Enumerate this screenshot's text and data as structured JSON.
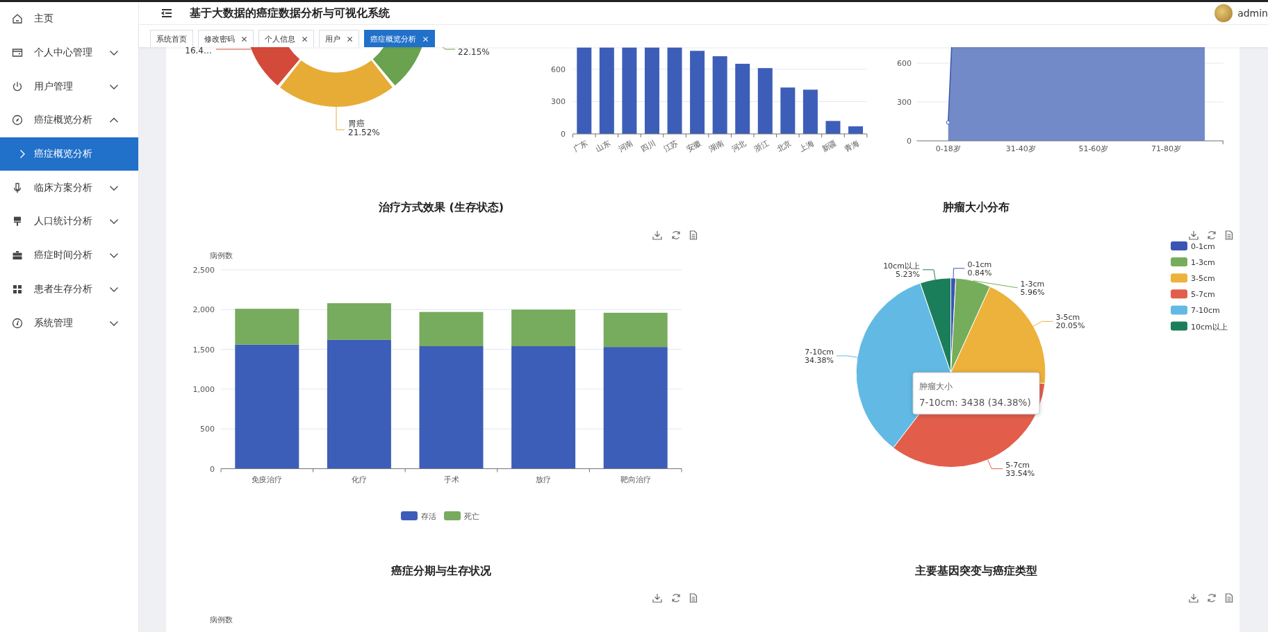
{
  "header": {
    "title": "基于大数据的癌症数据分析与可视化系统",
    "user": "admin"
  },
  "sidebar": {
    "items": [
      {
        "kind": "link",
        "label": "主页"
      },
      {
        "kind": "group",
        "label": "个人中心管理",
        "expanded": false
      },
      {
        "kind": "group",
        "label": "用户管理",
        "expanded": false
      },
      {
        "kind": "group",
        "label": "癌症概览分析",
        "expanded": true,
        "children": [
          {
            "label": "癌症概览分析",
            "selected": true
          }
        ]
      },
      {
        "kind": "group",
        "label": "临床方案分析",
        "expanded": false
      },
      {
        "kind": "group",
        "label": "人口统计分析",
        "expanded": false
      },
      {
        "kind": "group",
        "label": "癌症时间分析",
        "expanded": false
      },
      {
        "kind": "group",
        "label": "患者生存分析",
        "expanded": false
      },
      {
        "kind": "group",
        "label": "系统管理",
        "expanded": false
      }
    ]
  },
  "tabs": [
    {
      "label": "系统首页",
      "closable": false,
      "selected": false
    },
    {
      "label": "修改密码",
      "closable": true,
      "selected": false
    },
    {
      "label": "个人信息",
      "closable": true,
      "selected": false
    },
    {
      "label": "用户",
      "closable": true,
      "selected": false
    },
    {
      "label": "癌症概览分析",
      "closable": true,
      "selected": true
    }
  ],
  "charts": {
    "cancer_type_donut": {
      "kind": "picture",
      "segments": [
        {
          "percent": "16.4…",
          "color": "#d44a3a"
        },
        {
          "percent": "22.15%",
          "color": "#6aa24f"
        },
        {
          "name": "胃癌",
          "percent": "21.52%",
          "color": "#e7ac35"
        }
      ]
    },
    "province_bar": {
      "chart_data": {
        "type": "bar",
        "categories": [
          "广东",
          "山东",
          "河南",
          "四川",
          "江苏",
          "安徽",
          "湖南",
          "河北",
          "浙江",
          "北京",
          "上海",
          "新疆",
          "青海"
        ],
        "values": [
          800,
          800,
          800,
          800,
          800,
          770,
          720,
          650,
          610,
          430,
          410,
          120,
          70
        ],
        "ylim": [
          0,
          804
        ],
        "yticks": [
          0,
          300,
          600
        ]
      }
    },
    "age_area": {
      "kind": "picture",
      "x_labels": [
        "0-18岁",
        "31-40岁",
        "51-60岁",
        "71-80岁"
      ],
      "y_labels": [
        "600",
        "300",
        "0"
      ]
    },
    "treatment": {
      "chart_data": {
        "type": "bar",
        "stacked": true,
        "grid": true,
        "legend": true,
        "title": "治疗方式效果 (生存状态)",
        "ylabel": "病例数",
        "categories": [
          "免疫治疗",
          "化疗",
          "手术",
          "放疗",
          "靶向治疗"
        ],
        "series": [
          {
            "name": "存活",
            "color": "#3d5eb8",
            "values": [
              1560,
              1620,
              1540,
              1540,
              1530
            ]
          },
          {
            "name": "死亡",
            "color": "#77ab5d",
            "values": [
              450,
              460,
              430,
              460,
              430
            ]
          }
        ],
        "ylim": [
          0,
          2500
        ],
        "yticks": [
          {
            "value": 0,
            "label": "0"
          },
          {
            "value": 500,
            "label": "500"
          },
          {
            "value": 1000,
            "label": "1,000"
          },
          {
            "value": 1500,
            "label": "1,500"
          },
          {
            "value": 2000,
            "label": "2,000"
          },
          {
            "value": 2500,
            "label": "2,500"
          }
        ]
      }
    },
    "tumor_size": {
      "chart_data": {
        "type": "pie",
        "title": "肿瘤大小分布",
        "categories": [
          "0-1cm",
          "1-3cm",
          "3-5cm",
          "5-7cm",
          "7-10cm",
          "10cm以上"
        ],
        "values": [
          0.84,
          5.96,
          20.05,
          33.54,
          34.38,
          5.23
        ],
        "value_labels": [
          "0.84%",
          "5.96%",
          "20.05%",
          "33.54%",
          "34.38%",
          "5.23%"
        ]
      },
      "legend": [
        {
          "label": "0-1cm",
          "color": "#3a55b4"
        },
        {
          "label": "1-3cm",
          "color": "#76ad5a"
        },
        {
          "label": "3-5cm",
          "color": "#ecb23b"
        },
        {
          "label": "5-7cm",
          "color": "#e35d4b"
        },
        {
          "label": "7-10cm",
          "color": "#62bae4"
        },
        {
          "label": "10cm以上",
          "color": "#1b7e5b"
        }
      ],
      "tooltip": {
        "title": "肿瘤大小",
        "text": "7-10cm: 3438 (34.38%)"
      }
    },
    "stage": {
      "title": "癌症分期与生存状况",
      "ylabel": "病例数"
    },
    "gene": {
      "title": "主要基因突变与癌症类型"
    }
  }
}
